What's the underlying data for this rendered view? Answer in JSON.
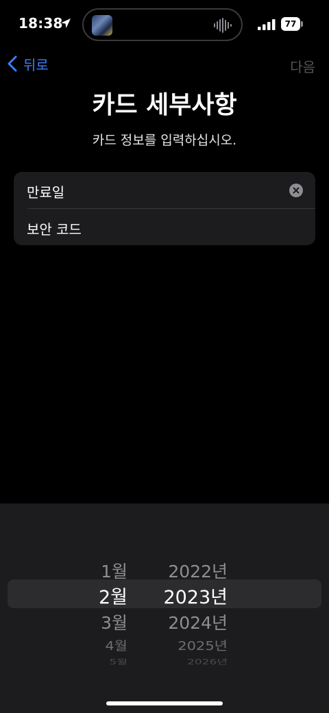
{
  "status_bar": {
    "time": "18:38",
    "battery": "77",
    "icons": [
      "location-arrow-icon",
      "album-art-icon",
      "audio-waveform-icon",
      "cellular-signal-icon",
      "battery-icon"
    ]
  },
  "nav": {
    "back_label": "뒤로",
    "next_label": "다음"
  },
  "header": {
    "title": "카드 세부사항",
    "subtitle": "카드 정보를 입력하십시오."
  },
  "form": {
    "fields": [
      {
        "label": "만료일",
        "has_clear_button": true
      },
      {
        "label": "보안 코드",
        "has_clear_button": false
      }
    ]
  },
  "picker": {
    "months": [
      "1월",
      "2월",
      "3월",
      "4월",
      "5월"
    ],
    "years": [
      "2022년",
      "2023년",
      "2024년",
      "2025년",
      "2026년"
    ],
    "selected_month": "2월",
    "selected_year": "2023년"
  },
  "colors": {
    "accent": "#3d7fff",
    "background": "#000000",
    "group_background": "#1c1c1e",
    "disabled_text": "#555555"
  }
}
